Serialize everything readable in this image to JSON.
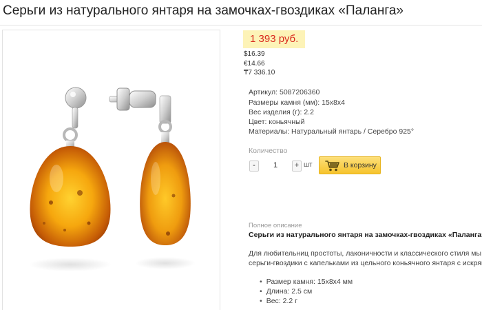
{
  "product": {
    "title": "Серьги из натурального янтаря на замочках-гвоздиках «Паланга»"
  },
  "price": {
    "main": "1 393 руб.",
    "usd": "$16.39",
    "eur": "€14.66",
    "kzt": "₸7 336.10",
    "accent_color": "#d9271c",
    "badge_color": "#fdf3b7"
  },
  "specs": [
    "Артикул: 5087206360",
    "Размеры камня (мм): 15х8х4",
    "Вес изделия (г): 2.2",
    "Цвет: коньячный",
    "Материалы: Натуральный янтарь / Серебро 925°"
  ],
  "purchase": {
    "qty_label": "Количество",
    "minus": "-",
    "plus": "+",
    "qty_value": "1",
    "unit": "шт",
    "cart_label": "В корзину",
    "cart_icon": "shopping-cart-icon"
  },
  "description": {
    "section_label": "Полное описание",
    "title": "Серьги из натурального янтаря на замочках-гвоздиках «Паланга»:",
    "lines": [
      "Для любительниц простоты, лаконичности и классического стиля мы и",
      "серьги-гвоздики с капельками из цельного коньячного янтаря с искрящ"
    ],
    "bullets": [
      "Размер камня: 15х8х4 мм",
      "Длина: 2.5 см",
      "Вес: 2.2 г"
    ]
  }
}
